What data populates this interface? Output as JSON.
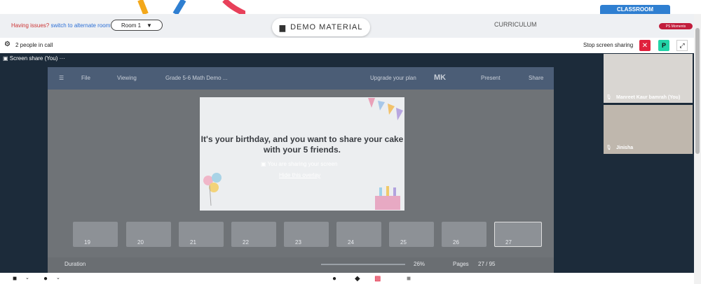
{
  "top": {
    "issues_text": "Having issues?",
    "issues_link": "switch to alternate room",
    "room_label": "Room 1",
    "demo_label": "DEMO MATERIAL",
    "curriculum_label": "CURRICULUM",
    "classroom_label": "CLASSROOM",
    "ps_moments_label": "PS Moments"
  },
  "call": {
    "people_count": "2 people in call",
    "stop_share": "Stop screen sharing",
    "p_label": "P"
  },
  "share_tab": "Screen share (You)",
  "canva": {
    "file": "File",
    "viewing": "Viewing",
    "doc_title": "Grade 5-6 Math Demo ...",
    "upgrade": "Upgrade your plan",
    "initials": "MK",
    "present": "Present",
    "share": "Share",
    "slide_text": "It's your birthday, and you want to share your cake with your 5 friends.",
    "overlay_sharing": "You are sharing your screen",
    "overlay_hide": "Hide this overlay",
    "thumbs": [
      "19",
      "20",
      "21",
      "22",
      "23",
      "24",
      "25",
      "26",
      "27"
    ],
    "duration": "Duration",
    "zoom": "26%",
    "pages": "Pages",
    "page_count": "27 / 95"
  },
  "participants": [
    {
      "name": "Manreet Kaur bamrah (You)"
    },
    {
      "name": "Jinisha"
    }
  ]
}
